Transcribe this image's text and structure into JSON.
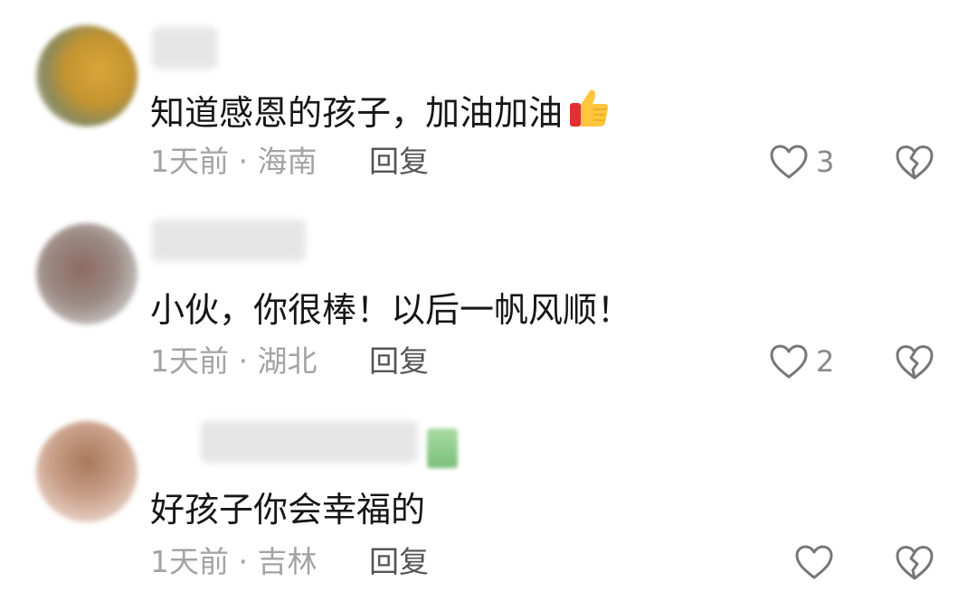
{
  "comments": [
    {
      "text": "知道感恩的孩子，加油加油",
      "emoji": "thumbs-up-icon",
      "time": "1天前",
      "separator": "·",
      "location": "海南",
      "reply_label": "回复",
      "likes": "3"
    },
    {
      "text": "小伙，你很棒！以后一帆风顺！",
      "time": "1天前",
      "separator": "·",
      "location": "湖北",
      "reply_label": "回复",
      "likes": "2"
    },
    {
      "text": "好孩子你会幸福的",
      "time": "1天前",
      "separator": "·",
      "location": "吉林",
      "reply_label": "回复",
      "likes": ""
    }
  ],
  "colors": {
    "text": "#161616",
    "meta": "#a3a3a3",
    "reply": "#555555",
    "icon": "#777777"
  }
}
